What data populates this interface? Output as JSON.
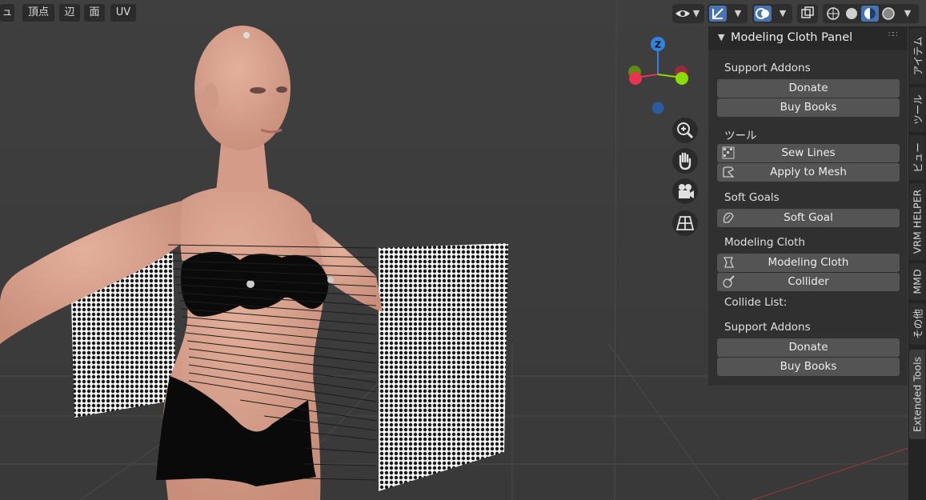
{
  "header": {
    "menu": [
      {
        "id": "mesh",
        "label": "ュ"
      },
      {
        "id": "vertex",
        "label": "頂点"
      },
      {
        "id": "edge",
        "label": "辺"
      },
      {
        "id": "face",
        "label": "面"
      },
      {
        "id": "uv",
        "label": "UV"
      }
    ]
  },
  "gizmo": {
    "z_label": "Z",
    "y_label": "Y",
    "x_label": "X"
  },
  "panel": {
    "title": "Modeling Cloth Panel",
    "sections": {
      "support1_label": "Support Addons",
      "donate1": "Donate",
      "books1": "Buy Books",
      "tools_label": "ツール",
      "sew_lines": "Sew Lines",
      "apply_mesh": "Apply to Mesh",
      "soft_goals_label": "Soft Goals",
      "soft_goal": "Soft Goal",
      "modeling_cloth_label": "Modeling Cloth",
      "modeling_cloth": "Modeling Cloth",
      "collider": "Collider",
      "collide_list_label": "Collide List:",
      "support2_label": "Support Addons",
      "donate2": "Donate",
      "books2": "Buy Books"
    }
  },
  "tabs": [
    {
      "label": "アイテム"
    },
    {
      "label": "ツール"
    },
    {
      "label": "ビュー"
    },
    {
      "label": "VRM HELPER"
    },
    {
      "label": "MMD"
    },
    {
      "label": "その他"
    },
    {
      "label": "Extended Tools"
    }
  ],
  "colors": {
    "viewport_bg": "#3d3d3d",
    "panel_bg": "#303030",
    "button_bg": "#545454",
    "skin": "#d9a38e",
    "cloth": "#0a0a0a",
    "accent_blue": "#4772b3",
    "axis_x": "#e8344e",
    "axis_y": "#8bdc00",
    "axis_z": "#2f83e2"
  }
}
